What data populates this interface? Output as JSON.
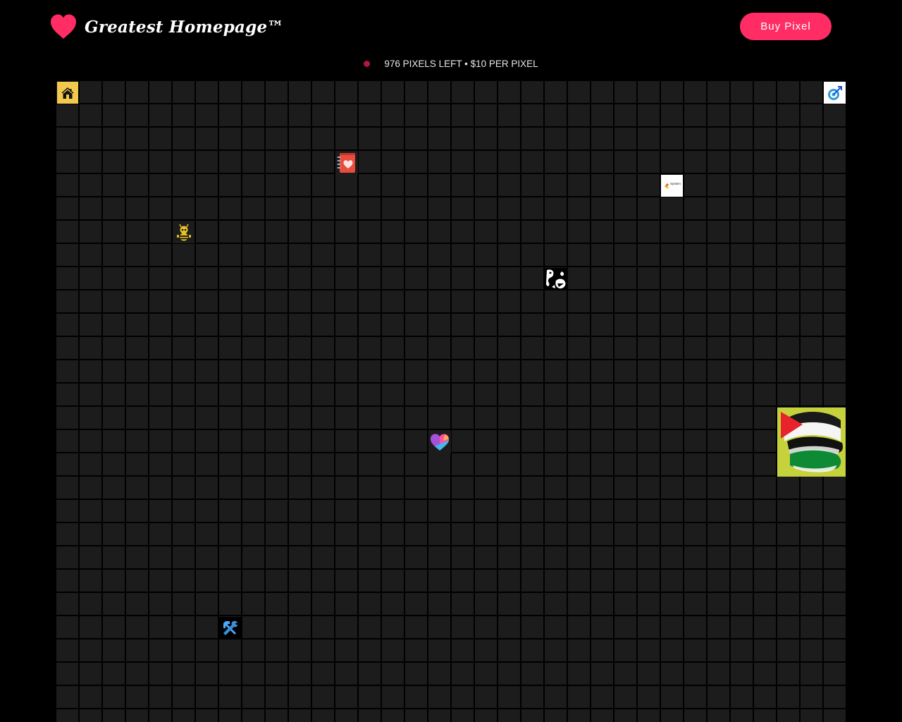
{
  "header": {
    "logo_text": "Greatest Homepage™",
    "buy_button_label": "Buy Pixel"
  },
  "status": {
    "text": "976 PIXELS LEFT • $10 PER PIXEL",
    "dot_color": "#b3163f"
  },
  "colors": {
    "accent": "#ff2d63",
    "cell": "#1c1c1c",
    "background": "#000000"
  },
  "grid": {
    "columns": 34,
    "rows": 28
  },
  "pixels": [
    {
      "icon": "house-icon"
    },
    {
      "icon": "target-arrow-icon"
    },
    {
      "icon": "heart-notebook-icon"
    },
    {
      "icon": "system-logo-icon",
      "label": "System"
    },
    {
      "icon": "bee-robot-icon"
    },
    {
      "icon": "black-white-art-icon"
    },
    {
      "icon": "palestine-flag-icon"
    },
    {
      "icon": "gradient-heart-icon"
    },
    {
      "icon": "hammer-wrench-icon"
    }
  ]
}
